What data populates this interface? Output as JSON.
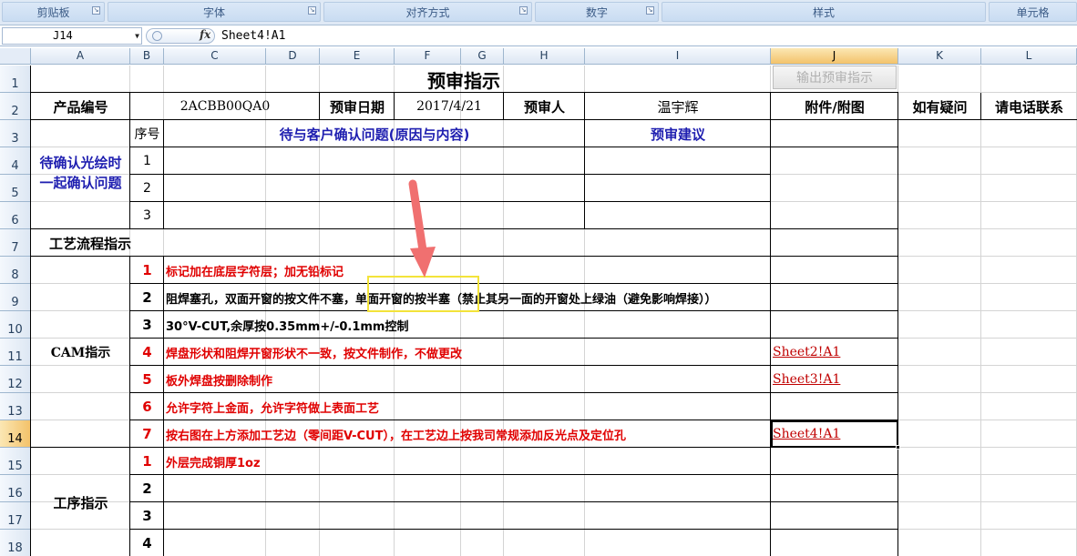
{
  "ribbon": {
    "groups": [
      "剪贴板",
      "字体",
      "对齐方式",
      "数字",
      "样式",
      "单元格"
    ]
  },
  "formula_bar": {
    "name_box": "J14",
    "fx": "fx",
    "formula": "Sheet4!A1"
  },
  "columns": [
    "A",
    "B",
    "C",
    "D",
    "E",
    "F",
    "G",
    "H",
    "I",
    "J",
    "K",
    "L"
  ],
  "rows": [
    "1",
    "2",
    "3",
    "4",
    "5",
    "6",
    "7",
    "8",
    "9",
    "10",
    "11",
    "12",
    "13",
    "14",
    "15",
    "16",
    "17",
    "18"
  ],
  "selected": {
    "column": "J",
    "row": "14"
  },
  "sheet": {
    "title": "预审指示",
    "export_button": "输出预审指示",
    "product_no_label": "产品编号",
    "product_no": "2ACBB00QA0",
    "review_date_label": "预审日期",
    "review_date": "2017/4/21",
    "reviewer_label": "预审人",
    "reviewer": "温宇辉",
    "attachment_label": "附件/附图",
    "question_label": "如有疑问",
    "phone_label": "请电话联系",
    "seq_label": "序号",
    "pending_header": "待与客户确认问题(原因与内容)",
    "suggestion_header": "预审建议",
    "confirm_label_1": "待确认光绘时",
    "confirm_label_2": "一起确认问题",
    "confirm_rows": [
      "1",
      "2",
      "3"
    ],
    "process_label": "工艺流程指示",
    "cam_label": "CAM指示",
    "cam_items": [
      {
        "no": "1",
        "text": "标记加在底层字符层；加无铅标记",
        "link": ""
      },
      {
        "no": "2",
        "text": "阻焊塞孔，双面开窗的按文件不塞，单面开窗的按半塞（禁止其另一面的开窗处上绿油（避免影响焊接））",
        "link": ""
      },
      {
        "no": "3",
        "text": "30°V-CUT,余厚按0.35mm+/-0.1mm控制",
        "link": ""
      },
      {
        "no": "4",
        "text": "焊盘形状和阻焊开窗形状不一致，按文件制作，不做更改",
        "link": "Sheet2!A1"
      },
      {
        "no": "5",
        "text": "板外焊盘按删除制作",
        "link": "Sheet3!A1"
      },
      {
        "no": "6",
        "text": "允许字符上金面，允许字符做上表面工艺",
        "link": ""
      },
      {
        "no": "7",
        "text": "按右图在上方添加工艺边（零间距V-CUT），在工艺边上按我司常规添加反光点及定位孔",
        "link": "Sheet4!A1"
      }
    ],
    "proc_label": "工序指示",
    "proc_items": [
      {
        "no": "1",
        "text": "外层完成铜厚1oz"
      },
      {
        "no": "2",
        "text": ""
      },
      {
        "no": "3",
        "text": ""
      },
      {
        "no": "4",
        "text": ""
      }
    ]
  },
  "colors": {
    "annotation_arrow": "#f07070",
    "highlight_box": "#f3e33a",
    "red_text": "#e00000",
    "blue_text": "#1f1fb0"
  }
}
